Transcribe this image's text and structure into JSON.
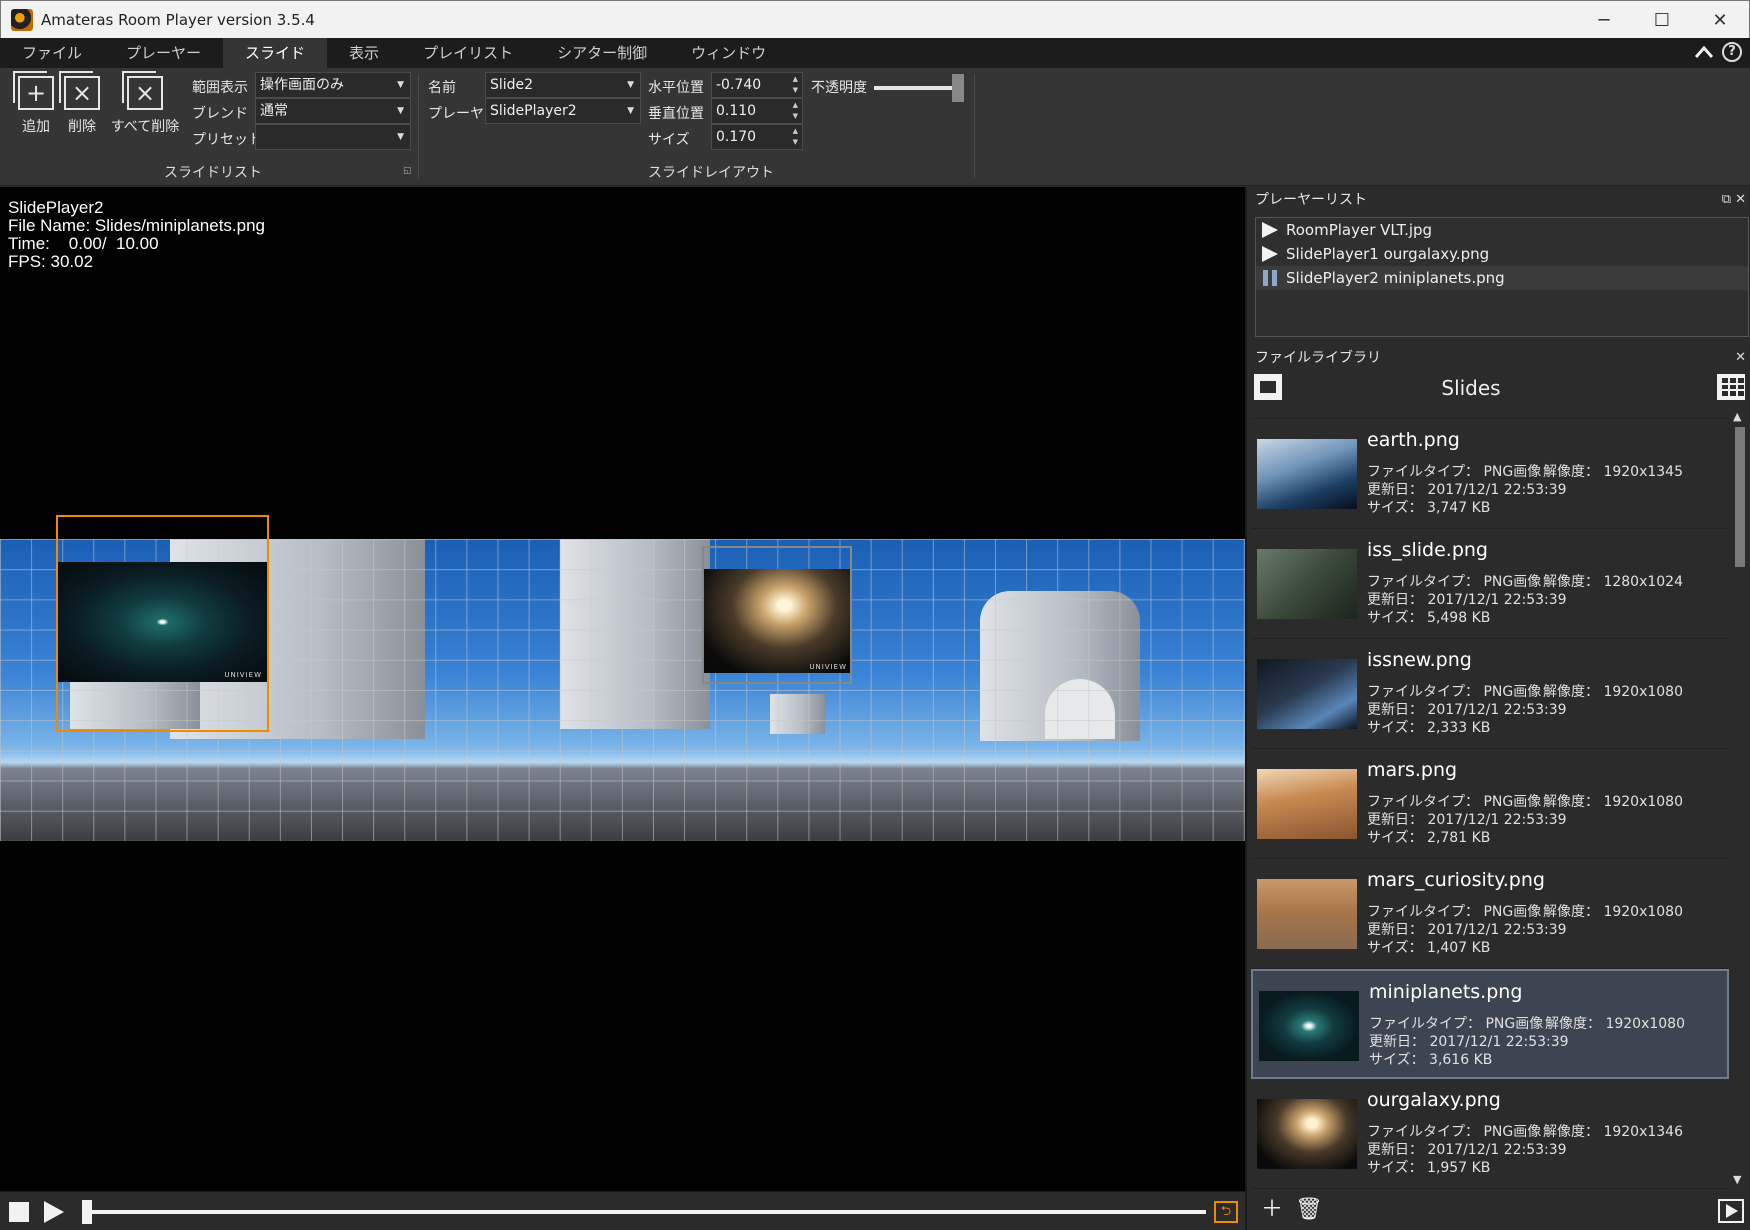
{
  "window": {
    "title": "Amateras Room Player version 3.5.4",
    "controls": [
      "─",
      "☐",
      "✕"
    ]
  },
  "menu": {
    "tabs": [
      "ファイル",
      "プレーヤー",
      "スライド",
      "表示",
      "プレイリスト",
      "シアター制御",
      "ウィンドウ"
    ],
    "active_index": 2
  },
  "ribbon": {
    "buttons": {
      "add": "追加",
      "delete": "削除",
      "delete_all": "すべて削除"
    },
    "slidelist": {
      "title": "スライドリスト",
      "range_label": "範囲表示",
      "range_value": "操作画面のみ",
      "blend_label": "ブレンド",
      "blend_value": "通常",
      "preset_label": "プリセット",
      "preset_value": ""
    },
    "layout": {
      "title": "スライドレイアウト",
      "name_label": "名前",
      "name_value": "Slide2",
      "player_label": "プレーヤー",
      "player_value": "SlidePlayer2",
      "hpos_label": "水平位置",
      "hpos_value": "-0.740",
      "vpos_label": "垂直位置",
      "vpos_value": "0.110",
      "size_label": "サイズ",
      "size_value": "0.170"
    },
    "opacity_label": "不透明度",
    "opacity_value": 1.0
  },
  "viewer": {
    "info": {
      "line1": "SlidePlayer2",
      "line2": "File Name: Slides/miniplanets.png",
      "line3": "Time:    0.00/  10.00",
      "line4": "FPS: 30.02"
    },
    "slide_watermark": "UNIVIEW"
  },
  "transport": {
    "position": 0.0
  },
  "player_list": {
    "title": "プレーヤーリスト",
    "items": [
      {
        "label": "RoomPlayer VLT.jpg",
        "state": "play"
      },
      {
        "label": "SlidePlayer1 ourgalaxy.png",
        "state": "play"
      },
      {
        "label": "SlidePlayer2 miniplanets.png",
        "state": "pause"
      }
    ]
  },
  "file_library": {
    "title": "ファイルライブラリ",
    "folder": "Slides",
    "type_label": "ファイルタイプ：",
    "date_label": "更新日：",
    "size_label": "サイズ：",
    "res_label": "解像度：",
    "files": [
      {
        "name": "earth.png",
        "type": "PNG画像",
        "date": "2017/12/1 22:53:39",
        "size": "3,747 KB",
        "res": "1920x1345"
      },
      {
        "name": "iss_slide.png",
        "type": "PNG画像",
        "date": "2017/12/1 22:53:39",
        "size": "5,498 KB",
        "res": "1280x1024"
      },
      {
        "name": "issnew.png",
        "type": "PNG画像",
        "date": "2017/12/1 22:53:39",
        "size": "2,333 KB",
        "res": "1920x1080"
      },
      {
        "name": "mars.png",
        "type": "PNG画像",
        "date": "2017/12/1 22:53:39",
        "size": "2,781 KB",
        "res": "1920x1080"
      },
      {
        "name": "mars_curiosity.png",
        "type": "PNG画像",
        "date": "2017/12/1 22:53:39",
        "size": "1,407 KB",
        "res": "1920x1080"
      },
      {
        "name": "miniplanets.png",
        "type": "PNG画像",
        "date": "2017/12/1 22:53:39",
        "size": "3,616 KB",
        "res": "1920x1080"
      },
      {
        "name": "ourgalaxy.png",
        "type": "PNG画像",
        "date": "2017/12/1 22:53:39",
        "size": "1,957 KB",
        "res": "1920x1346"
      }
    ],
    "selected_index": 5
  }
}
